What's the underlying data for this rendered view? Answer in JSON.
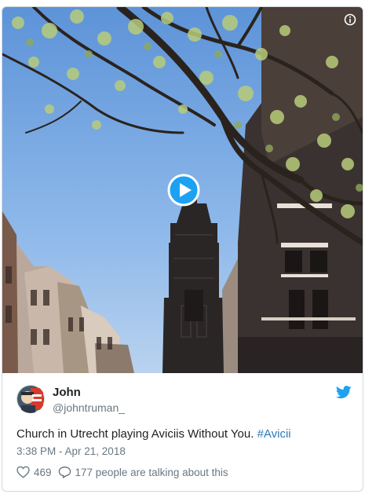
{
  "tweet": {
    "user": {
      "name": "John",
      "handle": "@johntruman_"
    },
    "text": "Church in Utrecht playing Aviciis Without You. ",
    "hashtag": "#Avicii",
    "timestamp": "3:38 PM - Apr 21, 2018",
    "likes": "469",
    "talking": "177 people are talking about this"
  },
  "media": {
    "type": "video",
    "description_icons": [
      "info-icon",
      "play-icon"
    ]
  },
  "colors": {
    "link": "#2b7bb9",
    "secondary_text": "#697882",
    "twitter_blue": "#1da1f2",
    "border": "#cfd9de"
  }
}
